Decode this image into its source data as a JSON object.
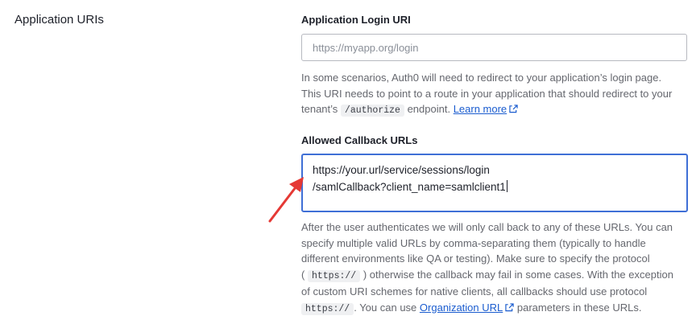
{
  "section": {
    "title": "Application URIs"
  },
  "login_uri": {
    "label": "Application Login URI",
    "placeholder": "https://myapp.org/login",
    "help_1": "In some scenarios, Auth0 will need to redirect to your application’s login page.",
    "help_2": "This URI needs to point to a route in your application that should redirect to your",
    "help_3a": "tenant’s",
    "help_code": "/authorize",
    "help_3b": "endpoint.",
    "help_link": "Learn more"
  },
  "callback_urls": {
    "label": "Allowed Callback URLs",
    "value_line1": "https://your.url/service/sessions/login",
    "value_line2": "/samlCallback?client_name=samlclient1",
    "help_1": "After the user authenticates we will only call back to any of these URLs. You can",
    "help_2": "specify multiple valid URLs by comma-separating them (typically to handle",
    "help_3": "different environments like QA or testing). Make sure to specify the protocol",
    "help_4a": "(",
    "help_code1": "https://",
    "help_4b": ") otherwise the callback may fail in some cases. With the exception",
    "help_5": "of custom URI schemes for native clients, all callbacks should use protocol",
    "help_code2": "https://",
    "help_6a": ". You can use",
    "help_link": "Organization URL",
    "help_6b": "parameters in these URLs."
  },
  "colors": {
    "focus_border": "#3f6fd6",
    "link": "#1a5ccf",
    "annotation_arrow": "#e53935"
  }
}
